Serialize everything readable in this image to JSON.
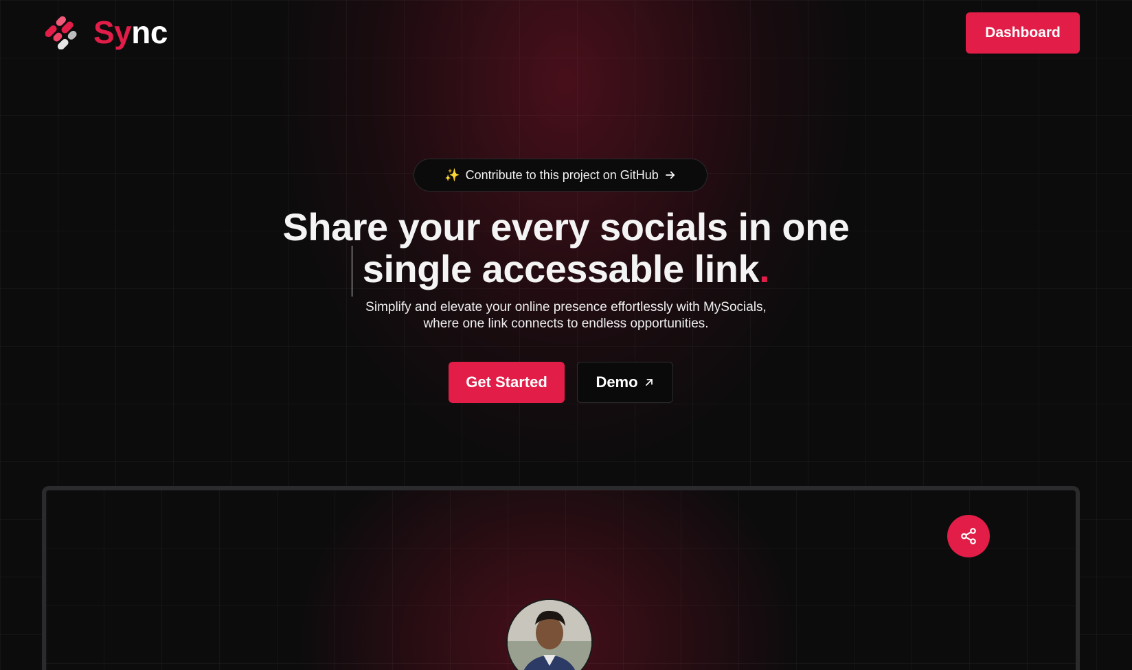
{
  "header": {
    "logo_prefix": "Sy",
    "logo_suffix": "nc",
    "dashboard_label": "Dashboard"
  },
  "hero": {
    "pill": {
      "sparkle": "✨",
      "label": "Contribute to this project on GitHub",
      "icon": "arrow-right-icon"
    },
    "headline_line1": "Share your every socials in one",
    "headline_line2": "single accessable link",
    "headline_dot": ".",
    "subtitle_line1": "Simplify and elevate your online presence effortlessly with MySocials,",
    "subtitle_line2": "where one link connects to endless opportunities.",
    "primary_cta": "Get Started",
    "secondary_cta": "Demo",
    "secondary_icon": "arrow-up-right-icon"
  },
  "preview": {
    "share_icon": "share-icon",
    "avatar": "profile-avatar"
  },
  "colors": {
    "accent": "#e11d48",
    "background": "#0d0c0d"
  }
}
